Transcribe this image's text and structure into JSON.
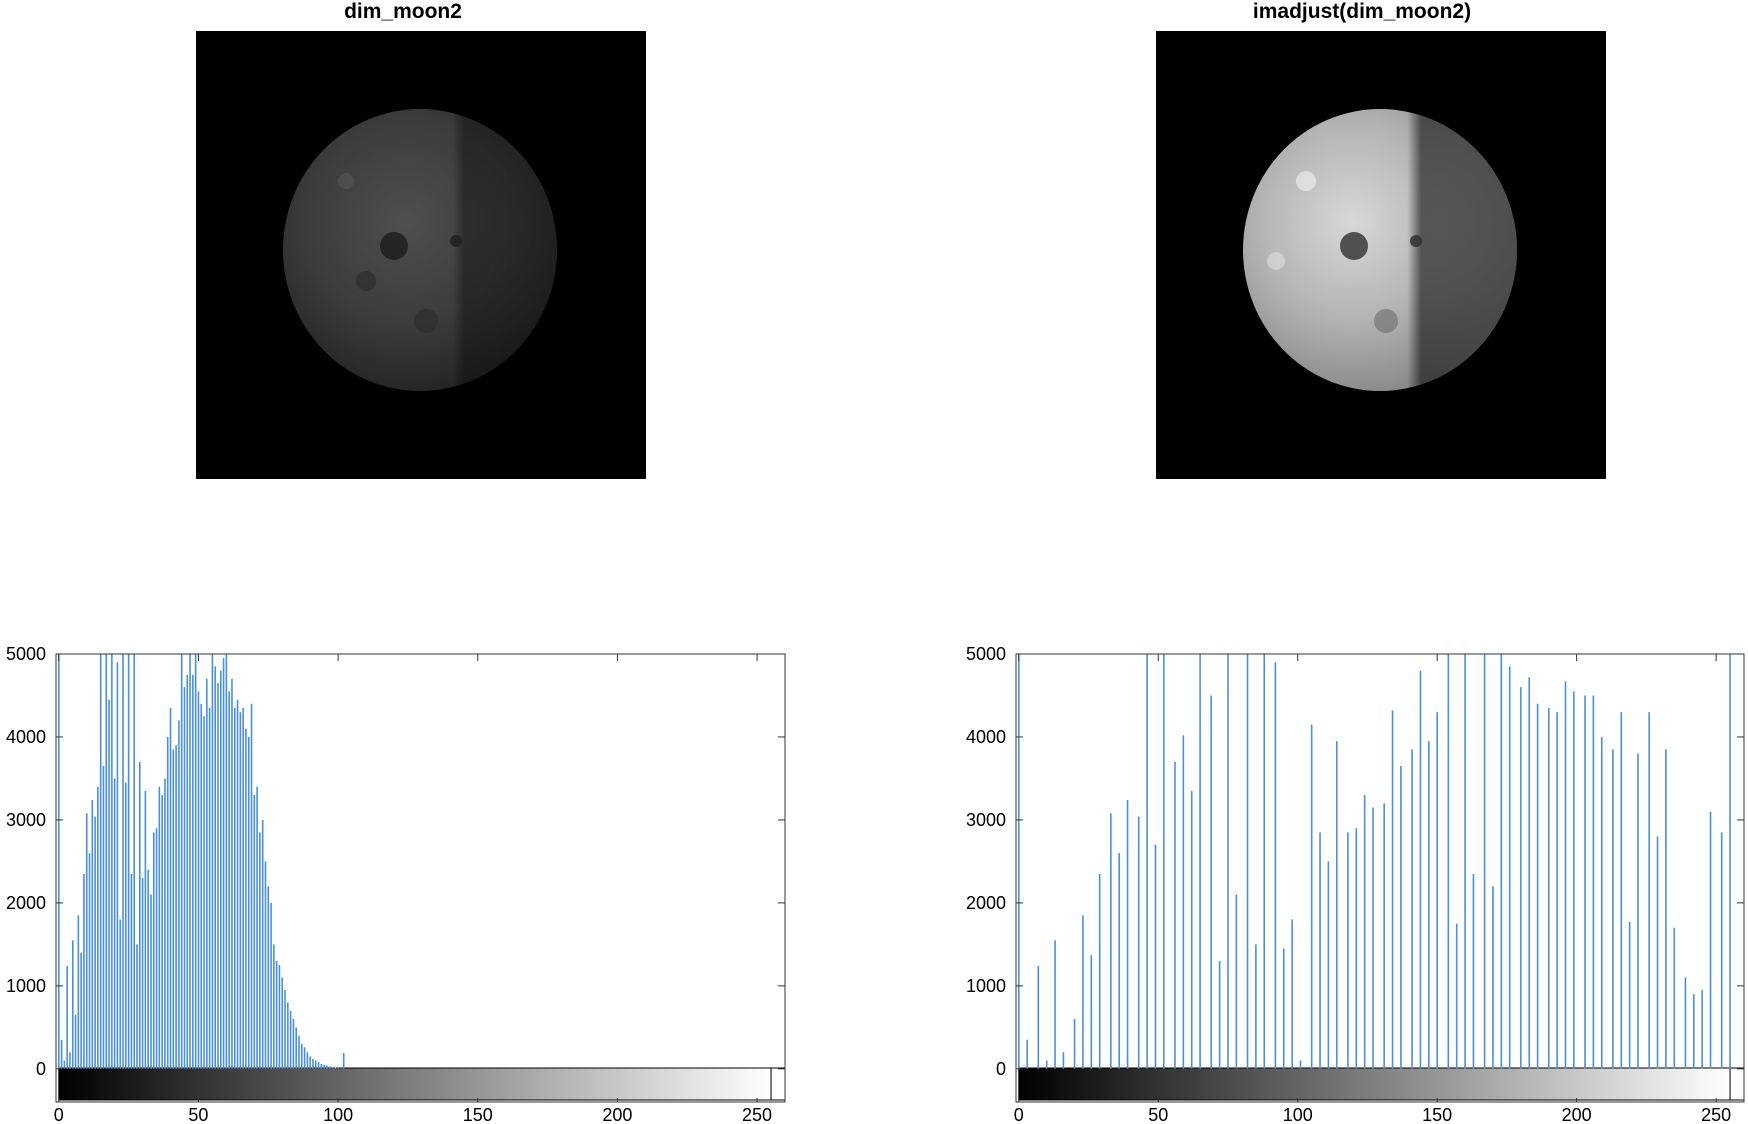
{
  "panels": [
    {
      "title": "dim_moon2"
    },
    {
      "title": "imadjust(dim_moon2)"
    }
  ],
  "colors": {
    "bar": "#4a90d9",
    "axis": "#333333",
    "image_bg": "#000000"
  },
  "chart_data": [
    {
      "type": "bar",
      "title": "",
      "xlabel": "",
      "ylabel": "",
      "xlim": [
        -1,
        260
      ],
      "ylim": [
        -400,
        5000
      ],
      "xticks": [
        0,
        50,
        100,
        150,
        200,
        250
      ],
      "yticks": [
        0,
        1000,
        2000,
        3000,
        4000,
        5000
      ],
      "xtick_labels": [
        "0",
        "50",
        "100",
        "150",
        "200",
        "250"
      ],
      "ytick_labels": [
        "0",
        "1000",
        "2000",
        "3000",
        "4000",
        "5000"
      ],
      "colorbar": "grayscale 0-255 below the axis",
      "x": [
        0,
        1,
        2,
        3,
        4,
        5,
        6,
        7,
        8,
        9,
        10,
        11,
        12,
        13,
        14,
        15,
        16,
        17,
        18,
        19,
        20,
        21,
        22,
        23,
        24,
        25,
        26,
        27,
        28,
        29,
        30,
        31,
        32,
        33,
        34,
        35,
        36,
        37,
        38,
        39,
        40,
        41,
        42,
        43,
        44,
        45,
        46,
        47,
        48,
        49,
        50,
        51,
        52,
        53,
        54,
        55,
        56,
        57,
        58,
        59,
        60,
        61,
        62,
        63,
        64,
        65,
        66,
        67,
        68,
        69,
        70,
        71,
        72,
        73,
        74,
        75,
        76,
        77,
        78,
        79,
        80,
        81,
        82,
        83,
        84,
        85,
        86,
        87,
        88,
        89,
        90,
        91,
        92,
        93,
        94,
        95,
        96,
        97,
        98,
        99,
        100,
        101,
        102
      ],
      "values": [
        5000,
        350,
        100,
        1240,
        200,
        1550,
        650,
        1850,
        1400,
        2350,
        3080,
        2600,
        3240,
        3040,
        3400,
        5000,
        3650,
        5000,
        4450,
        5000,
        3500,
        4900,
        1800,
        5000,
        3450,
        5000,
        2350,
        5000,
        1500,
        3700,
        2300,
        3350,
        2400,
        2100,
        2850,
        2900,
        3400,
        3300,
        3500,
        4000,
        4350,
        3850,
        3900,
        4200,
        5000,
        4600,
        4750,
        5000,
        4750,
        5000,
        4550,
        4400,
        4250,
        4700,
        4350,
        5000,
        4850,
        4650,
        4800,
        4950,
        5000,
        4550,
        4700,
        4350,
        4450,
        4300,
        4350,
        4100,
        4000,
        4400,
        3300,
        3400,
        2850,
        3000,
        2500,
        2200,
        2000,
        1500,
        1300,
        1250,
        1100,
        950,
        800,
        700,
        600,
        500,
        400,
        300,
        260,
        200,
        150,
        120,
        100,
        80,
        60,
        50,
        40,
        30,
        20,
        15,
        10,
        5,
        190
      ]
    },
    {
      "type": "bar",
      "title": "",
      "xlabel": "",
      "ylabel": "",
      "xlim": [
        -1,
        260
      ],
      "ylim": [
        -400,
        5000
      ],
      "xticks": [
        0,
        50,
        100,
        150,
        200,
        250
      ],
      "yticks": [
        0,
        1000,
        2000,
        3000,
        4000,
        5000
      ],
      "xtick_labels": [
        "0",
        "50",
        "100",
        "150",
        "200",
        "250"
      ],
      "ytick_labels": [
        "0",
        "1000",
        "2000",
        "3000",
        "4000",
        "5000"
      ],
      "colorbar": "grayscale 0-255 below the axis",
      "x": [
        0,
        3,
        7,
        10,
        13,
        16,
        20,
        23,
        26,
        29,
        33,
        36,
        39,
        43,
        46,
        49,
        52,
        56,
        59,
        62,
        65,
        69,
        72,
        75,
        78,
        82,
        85,
        88,
        92,
        95,
        98,
        101,
        105,
        108,
        111,
        114,
        118,
        121,
        124,
        127,
        131,
        134,
        137,
        141,
        144,
        147,
        150,
        154,
        157,
        160,
        163,
        167,
        170,
        173,
        176,
        180,
        183,
        186,
        190,
        193,
        196,
        199,
        203,
        206,
        209,
        213,
        216,
        219,
        222,
        226,
        229,
        232,
        235,
        239,
        242,
        245,
        248,
        252,
        255
      ],
      "values": [
        5000,
        350,
        1240,
        100,
        1550,
        200,
        600,
        1850,
        1370,
        2350,
        3080,
        2600,
        3240,
        3040,
        5000,
        2700,
        5000,
        3700,
        4020,
        3350,
        5000,
        4500,
        1300,
        5000,
        2100,
        5000,
        1500,
        5000,
        4900,
        1450,
        1800,
        100,
        4150,
        2850,
        2500,
        3950,
        2850,
        2900,
        3300,
        3150,
        3200,
        4320,
        3650,
        3850,
        4800,
        3950,
        4300,
        5000,
        1750,
        5000,
        2350,
        5000,
        2200,
        5000,
        4850,
        4600,
        4720,
        4400,
        4350,
        4300,
        4670,
        4550,
        4500,
        4500,
        4000,
        3850,
        4300,
        1770,
        3800,
        4300,
        2800,
        3850,
        1700,
        1100,
        900,
        950,
        3100,
        2850,
        5000
      ]
    }
  ]
}
